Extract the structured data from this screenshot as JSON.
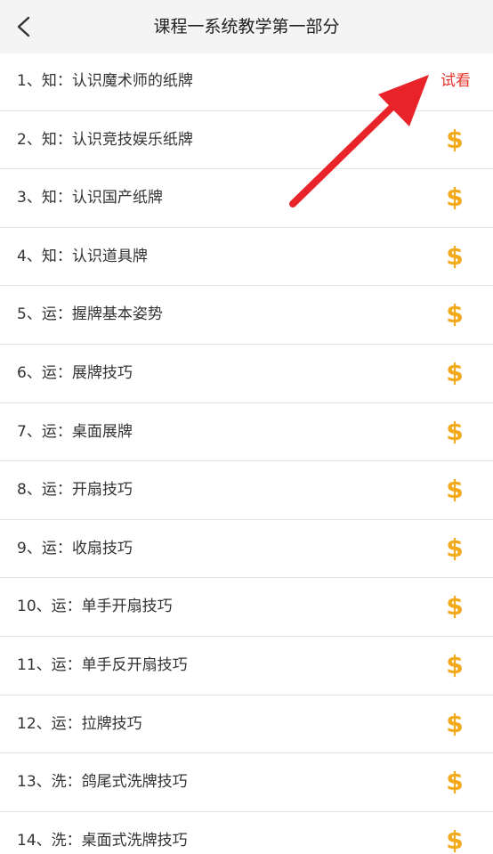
{
  "header": {
    "title": "课程一系统教学第一部分"
  },
  "lessons": [
    {
      "title": "1、知：认识魔术师的纸牌",
      "tag": "试看",
      "tag_type": "trial"
    },
    {
      "title": "2、知：认识竞技娱乐纸牌",
      "tag": "$",
      "tag_type": "paid"
    },
    {
      "title": "3、知：认识国产纸牌",
      "tag": "$",
      "tag_type": "paid"
    },
    {
      "title": "4、知：认识道具牌",
      "tag": "$",
      "tag_type": "paid"
    },
    {
      "title": "5、运：握牌基本姿势",
      "tag": "$",
      "tag_type": "paid"
    },
    {
      "title": "6、运：展牌技巧",
      "tag": "$",
      "tag_type": "paid"
    },
    {
      "title": "7、运：桌面展牌",
      "tag": "$",
      "tag_type": "paid"
    },
    {
      "title": "8、运：开扇技巧",
      "tag": "$",
      "tag_type": "paid"
    },
    {
      "title": "9、运：收扇技巧",
      "tag": "$",
      "tag_type": "paid"
    },
    {
      "title": "10、运：单手开扇技巧",
      "tag": "$",
      "tag_type": "paid"
    },
    {
      "title": "11、运：单手反开扇技巧",
      "tag": "$",
      "tag_type": "paid"
    },
    {
      "title": "12、运：拉牌技巧",
      "tag": "$",
      "tag_type": "paid"
    },
    {
      "title": "13、洗：鸽尾式洗牌技巧",
      "tag": "$",
      "tag_type": "paid"
    },
    {
      "title": "14、洗：桌面式洗牌技巧",
      "tag": "$",
      "tag_type": "paid"
    }
  ],
  "colors": {
    "trial": "#e8342f",
    "paid": "#f2a91a",
    "annotation_arrow": "#e8242a"
  },
  "icons": {
    "back": "chevron-left-icon",
    "paid": "dollar-icon",
    "annotation": "red-arrow-icon"
  }
}
